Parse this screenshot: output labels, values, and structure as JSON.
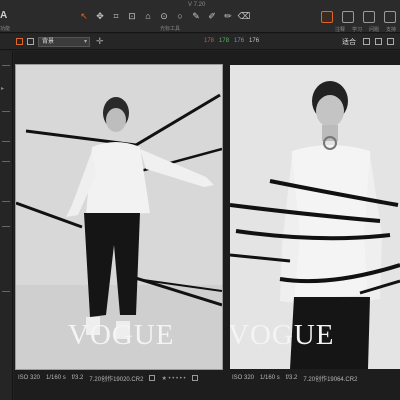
{
  "app": {
    "version": "V 7.20",
    "logo_letter": "A",
    "logo_caption": "功能"
  },
  "toolbar": {
    "tools_label": "光标工具",
    "icons": [
      "cursor-tool-icon",
      "pan-tool-icon",
      "crop-tool-icon",
      "straighten-tool-icon",
      "keystone-tool-icon",
      "spot-tool-icon",
      "circle-tool-icon",
      "pen-tool-icon",
      "picker-tool-icon",
      "brush-tool-icon",
      "eraser-tool-icon"
    ],
    "right_labels": [
      "注释",
      "学习",
      "问题",
      "支持"
    ]
  },
  "subbar": {
    "background_select": "背景",
    "rgb": {
      "r": "178",
      "g": "178",
      "b": "176",
      "a": "176"
    },
    "fit_label": "适合"
  },
  "photos": [
    {
      "vogue_text": "VOGUE",
      "iso": "ISO 320",
      "shutter": "1/160 s",
      "aperture": "f/3.2",
      "filename": "7.20创作19020.CR2"
    },
    {
      "vogue_text": "VOGUE",
      "iso": "ISO 320",
      "shutter": "1/160 s",
      "aperture": "f/3.2",
      "filename": "7.20创作19064.CR2"
    }
  ],
  "colors": {
    "accent": "#e0672b",
    "red": "#d9534f",
    "green": "#5cb85c",
    "blue": "#5b9bd5"
  }
}
